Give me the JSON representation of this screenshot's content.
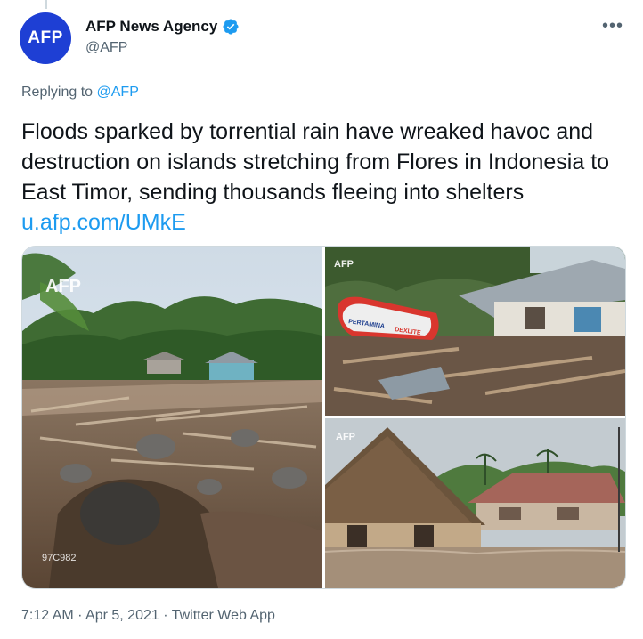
{
  "author": {
    "avatar_text": "AFP",
    "name": "AFP News Agency",
    "handle": "@AFP",
    "verified_icon": "verified-badge-icon",
    "more_icon": "more-options-icon"
  },
  "reply": {
    "prefix": "Replying to",
    "to": "@AFP"
  },
  "tweet": {
    "text": "Floods sparked by torrential rain have wreaked havoc and destruction on islands stretching from Flores in Indonesia to East Timor, sending thousands fleeing into shelters",
    "link": "u.afp.com/UMkE"
  },
  "media": {
    "watermark": "AFP",
    "photo1_code": "97C982",
    "boat_text_1": "PERTAMINA",
    "boat_text_2": "DEXLITE"
  },
  "meta": {
    "time": "7:12 AM",
    "date": "Apr 5, 2021",
    "client": "Twitter Web App",
    "separator": "·"
  },
  "colors": {
    "link": "#1d9bf0",
    "secondary_text": "#536471",
    "avatar_bg": "#1e3fd4"
  }
}
